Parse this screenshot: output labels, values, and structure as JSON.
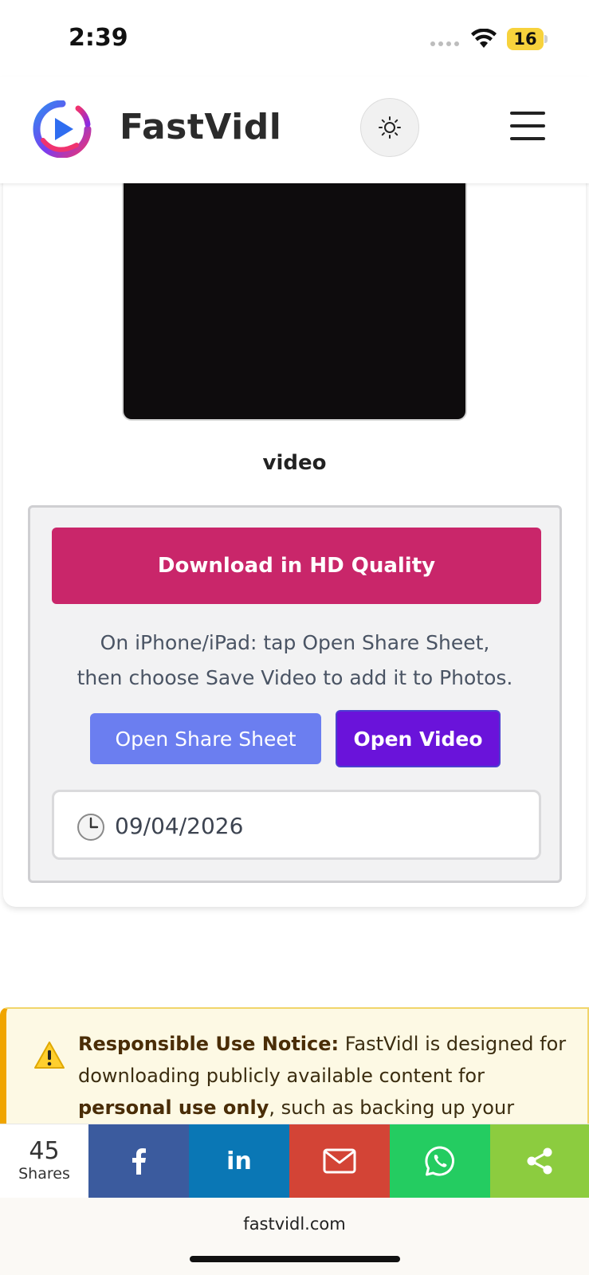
{
  "status_bar": {
    "time": "2:39",
    "battery": "16"
  },
  "header": {
    "brand": "FastVidl",
    "icons": {
      "logo": "fastvidl-logo-icon",
      "theme": "sun-icon",
      "menu": "hamburger-menu-icon"
    }
  },
  "main": {
    "video_title": "video",
    "download_button": "Download in HD Quality",
    "instruction_line1": "On iPhone/iPad: tap Open Share Sheet,",
    "instruction_line2": "then choose Save Video to add it to Photos.",
    "share_sheet_button": "Open Share Sheet",
    "open_video_button": "Open Video",
    "date": "09/04/2026"
  },
  "notice": {
    "heading": "Responsible Use Notice:",
    "text1": " FastVidl is designed for downloading publicly available content for ",
    "bold2": "personal use only",
    "text2": ", such as backing up your"
  },
  "share_bar": {
    "count": "45",
    "count_label": "Shares",
    "linkedin_label": "in"
  },
  "address_bar": {
    "url": "fastvidl.com"
  },
  "colors": {
    "hd_button": "#c9266a",
    "share_sheet": "#6b7ef0",
    "open_video": "#6a13da",
    "facebook": "#3b5b9e",
    "linkedin": "#0a77b5",
    "email": "#d34436",
    "whatsapp": "#24cc61",
    "share": "#8ccc3f"
  }
}
